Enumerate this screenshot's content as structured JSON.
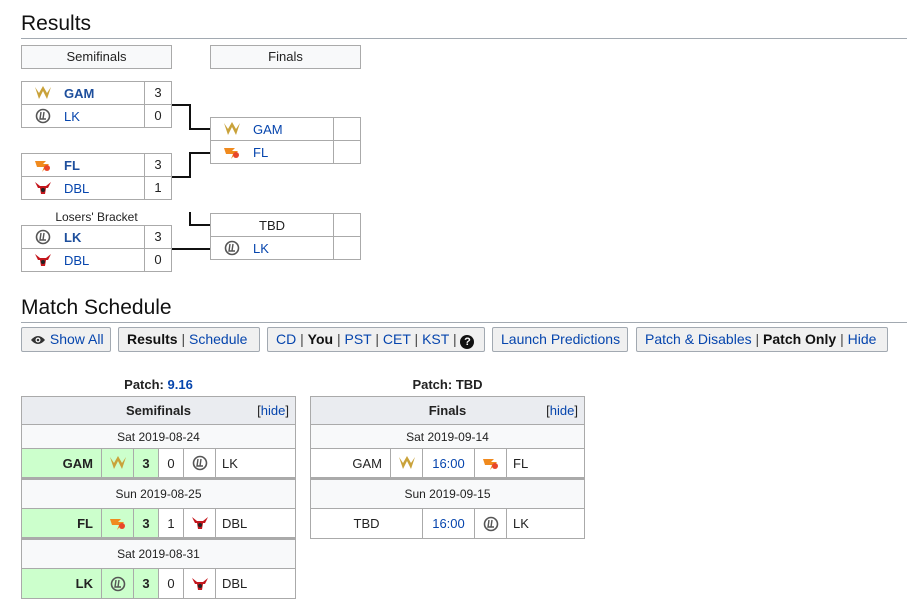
{
  "results": {
    "title": "Results",
    "semifinals_header": "Semifinals",
    "finals_header": "Finals",
    "losers_bracket_label": "Losers' Bracket",
    "semi1": [
      {
        "team": "GAM",
        "score": "3",
        "icon": "gam-logo"
      },
      {
        "team": "LK",
        "score": "0",
        "icon": "lk-logo"
      }
    ],
    "semi2": [
      {
        "team": "FL",
        "score": "3",
        "icon": "fl-logo"
      },
      {
        "team": "DBL",
        "score": "1",
        "icon": "dbl-logo"
      }
    ],
    "losers": [
      {
        "team": "LK",
        "score": "3",
        "icon": "lk-logo"
      },
      {
        "team": "DBL",
        "score": "0",
        "icon": "dbl-logo"
      }
    ],
    "final1": [
      {
        "team": "GAM",
        "score": "",
        "icon": "gam-logo"
      },
      {
        "team": "FL",
        "score": "",
        "icon": "fl-logo"
      }
    ],
    "final2": [
      {
        "team": "TBD",
        "score": ""
      },
      {
        "team": "LK",
        "score": "",
        "icon": "lk-logo"
      }
    ]
  },
  "schedule": {
    "title": "Match Schedule",
    "buttons": {
      "show_all": "Show All",
      "results": "Results",
      "schedule": "Schedule",
      "tz_cd": "CD",
      "tz_you": "You",
      "tz_pst": "PST",
      "tz_cet": "CET",
      "tz_kst": "KST",
      "help": "?",
      "launch_predictions": "Launch Predictions",
      "patch_disables": "Patch & Disables",
      "patch_only": "Patch Only",
      "hide": "Hide"
    },
    "semis": {
      "patch_label": "Patch:",
      "patch_value": "9.16",
      "header": "Semifinals",
      "hide": "hide",
      "matches": [
        {
          "date": "Sat 2019-08-24",
          "team1": "GAM",
          "s1": "3",
          "s2": "0",
          "team2": "LK"
        },
        {
          "date": "Sun 2019-08-25",
          "team1": "FL",
          "s1": "3",
          "s2": "1",
          "team2": "DBL"
        },
        {
          "date": "Sat 2019-08-31",
          "team1": "LK",
          "s1": "3",
          "s2": "0",
          "team2": "DBL"
        }
      ]
    },
    "finals": {
      "patch_label": "Patch:",
      "patch_value": "TBD",
      "header": "Finals",
      "hide": "hide",
      "matches": [
        {
          "date": "Sat 2019-09-14",
          "team1": "GAM",
          "time": "16:00",
          "team2": "FL"
        },
        {
          "date": "Sun 2019-09-15",
          "team1": "TBD",
          "time": "16:00",
          "team2": "LK"
        }
      ]
    }
  },
  "colors": {
    "link": "#0645ad",
    "win_bg": "#ccffcc",
    "gam": "#c9a23a",
    "fl": "#f08a1e",
    "dbl": "#c4161c",
    "lk": "#555555"
  }
}
